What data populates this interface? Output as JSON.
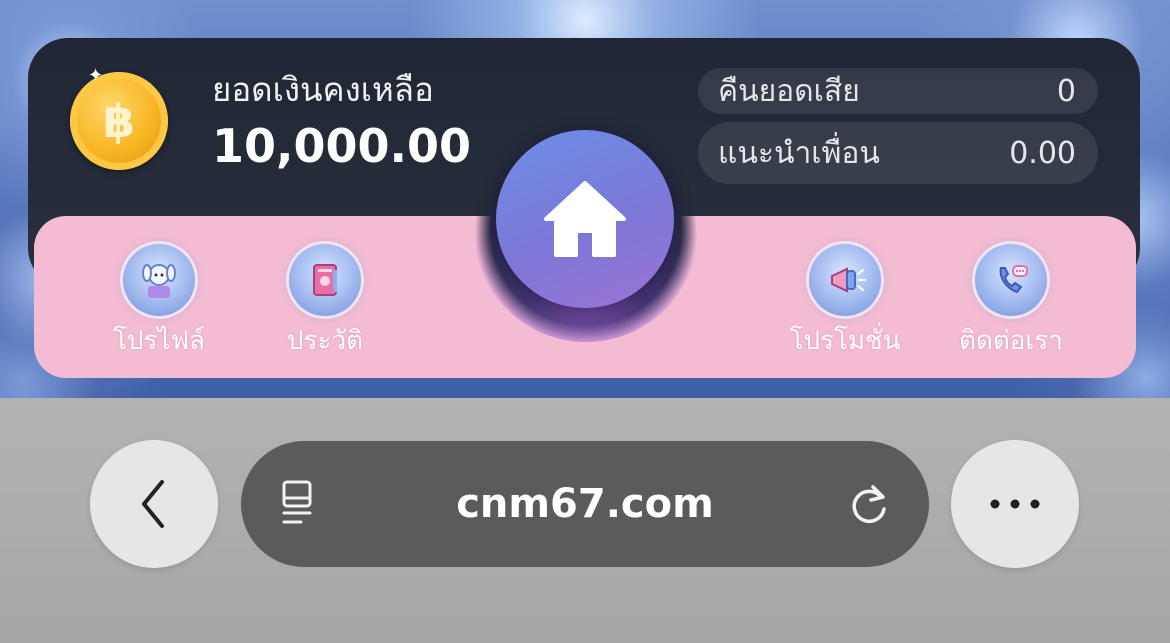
{
  "wallet": {
    "balance_label": "ยอดเงินคงเหลือ",
    "balance_value": "10,000.00",
    "coin_symbol": "฿",
    "stats": [
      {
        "label": "คืนยอดเสีย",
        "value": "0"
      },
      {
        "label": "แนะนำเพื่อน",
        "value": "0.00"
      }
    ]
  },
  "nav": {
    "items": [
      {
        "label": "โปรไฟล์",
        "icon": "profile-icon"
      },
      {
        "label": "ประวัติ",
        "icon": "history-book-icon"
      },
      {
        "label": "โปรโมชั่น",
        "icon": "megaphone-icon"
      },
      {
        "label": "ติดต่อเรา",
        "icon": "contact-phone-icon"
      }
    ],
    "home_icon": "home-icon"
  },
  "browser": {
    "url": "cnm67.com",
    "left_icon": "reader-icon",
    "right_icon": "reload-icon",
    "back_icon": "back-chevron-icon",
    "more_icon": "more-dots-icon"
  },
  "colors": {
    "panel": "#1f2635",
    "navbar": "#f4bcd2",
    "home_button": "#7d77d8",
    "url_bar": "#5b5b5b"
  }
}
